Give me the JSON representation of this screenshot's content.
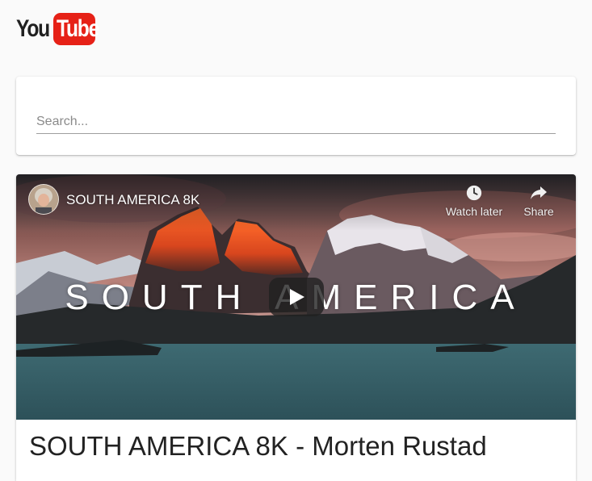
{
  "logo": {
    "part1": "You",
    "part2": "Tube"
  },
  "search": {
    "placeholder": "Search...",
    "value": ""
  },
  "video": {
    "overlay_title": "SOUTH AMERICA 8K",
    "thumbnail_text": "SOUTH AMERICA",
    "watch_later_label": "Watch later",
    "share_label": "Share",
    "heading": "SOUTH AMERICA 8K - Morten Rustad"
  },
  "icons": {
    "clock": "clock-icon",
    "share": "share-arrow-icon",
    "play": "play-icon"
  },
  "colors": {
    "brand_red": "#e62117",
    "page_bg": "#fafafa",
    "card_bg": "#ffffff"
  }
}
